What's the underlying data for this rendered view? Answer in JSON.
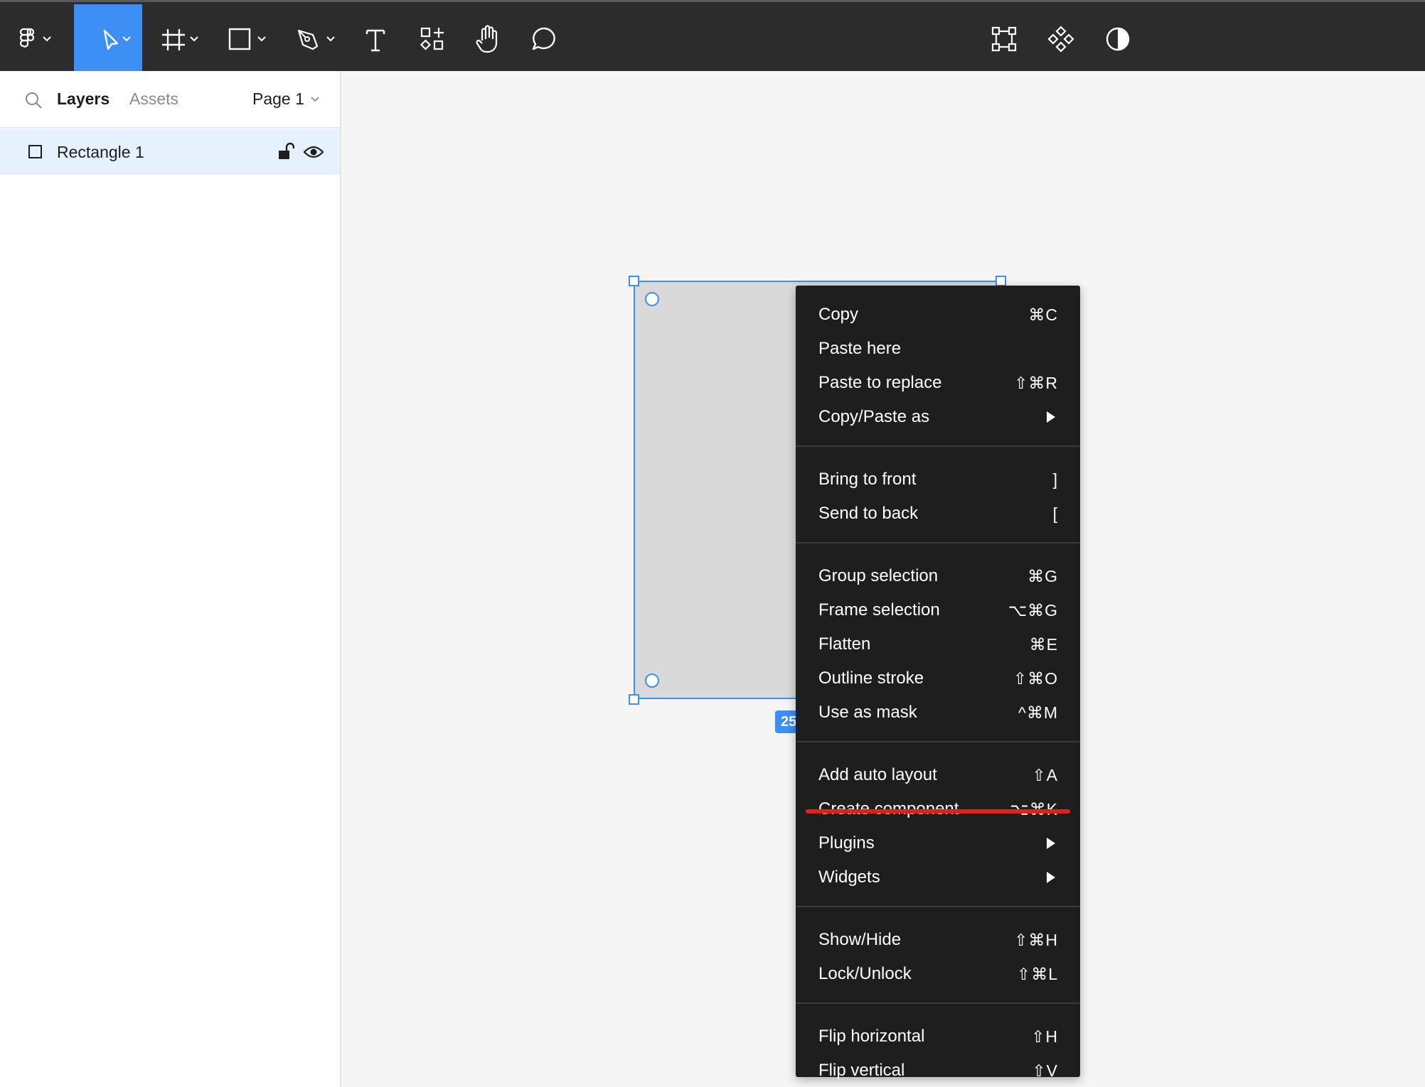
{
  "toolbar": {
    "tools": [
      "figma-menu",
      "move-tool",
      "frame-tool",
      "shape-tool",
      "pen-tool",
      "text-tool",
      "resources-tool",
      "hand-tool",
      "comment-tool"
    ],
    "right_tools": [
      "edit-object",
      "component",
      "dark-mode-toggle"
    ],
    "active_tool": "move-tool",
    "accent": "#3d8ef5"
  },
  "left_panel": {
    "tabs": {
      "layers": "Layers",
      "assets": "Assets"
    },
    "page": "Page 1",
    "layers": [
      {
        "name": "Rectangle 1",
        "selected": true
      }
    ]
  },
  "canvas": {
    "size_badge": "25"
  },
  "context_menu": {
    "groups": [
      [
        {
          "label": "Copy",
          "shortcut": "⌘C"
        },
        {
          "label": "Paste here",
          "shortcut": ""
        },
        {
          "label": "Paste to replace",
          "shortcut": "⇧⌘R"
        },
        {
          "label": "Copy/Paste as",
          "submenu": true
        }
      ],
      [
        {
          "label": "Bring to front",
          "shortcut": "]"
        },
        {
          "label": "Send to back",
          "shortcut": "["
        }
      ],
      [
        {
          "label": "Group selection",
          "shortcut": "⌘G"
        },
        {
          "label": "Frame selection",
          "shortcut": "⌥⌘G"
        },
        {
          "label": "Flatten",
          "shortcut": "⌘E"
        },
        {
          "label": "Outline stroke",
          "shortcut": "⇧⌘O"
        },
        {
          "label": "Use as mask",
          "shortcut": "^⌘M"
        }
      ],
      [
        {
          "label": "Add auto layout",
          "shortcut": "⇧A"
        },
        {
          "label": "Create component",
          "shortcut": "⌥⌘K",
          "highlighted": true
        },
        {
          "label": "Plugins",
          "submenu": true
        },
        {
          "label": "Widgets",
          "submenu": true
        }
      ],
      [
        {
          "label": "Show/Hide",
          "shortcut": "⇧⌘H"
        },
        {
          "label": "Lock/Unlock",
          "shortcut": "⇧⌘L"
        }
      ],
      [
        {
          "label": "Flip horizontal",
          "shortcut": "⇧H"
        },
        {
          "label": "Flip vertical",
          "shortcut": "⇧V"
        }
      ]
    ],
    "highlight_color": "#e0201a"
  }
}
